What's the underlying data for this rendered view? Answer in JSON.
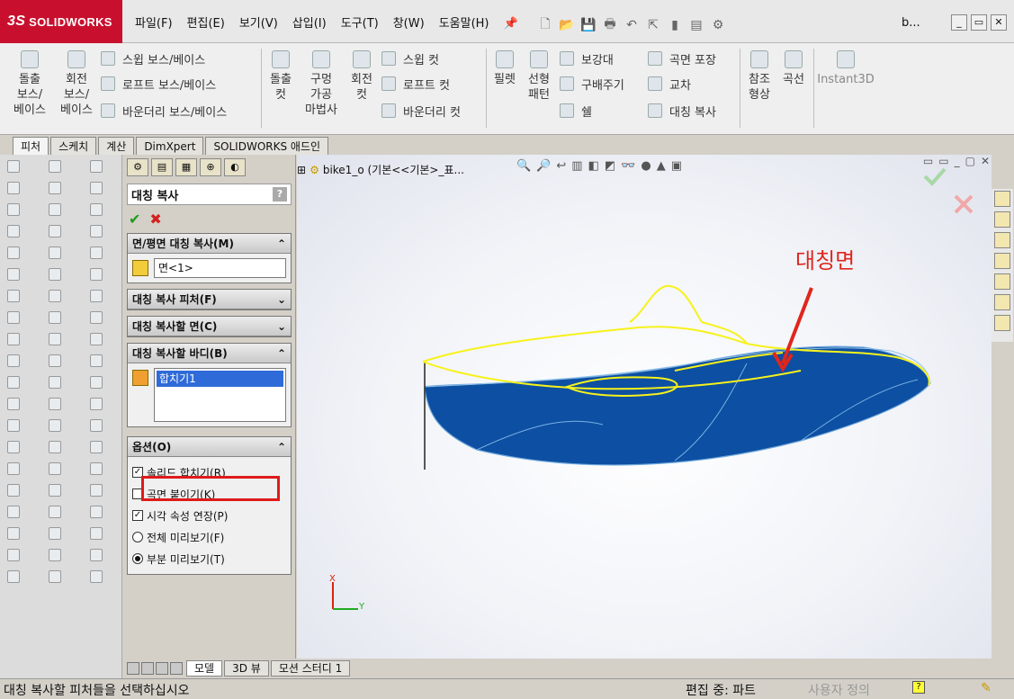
{
  "app": {
    "logo": "SOLIDWORKS",
    "doc_title": "b..."
  },
  "menu": [
    "파일(F)",
    "편집(E)",
    "보기(V)",
    "삽입(I)",
    "도구(T)",
    "창(W)",
    "도움말(H)"
  ],
  "ribbon": {
    "extrude_boss": "돌출\n보스/\n베이스",
    "revolve_boss": "회전\n보스/\n베이스",
    "sweep_boss": "스윕 보스/베이스",
    "loft_boss": "로프트 보스/베이스",
    "boundary_boss": "바운더리 보스/베이스",
    "extrude_cut": "돌출\n컷",
    "hole_wizard": "구멍\n가공\n마법사",
    "revolve_cut": "회전\n컷",
    "sweep_cut": "스윕 컷",
    "loft_cut": "로프트 컷",
    "boundary_cut": "바운더리 컷",
    "fillet": "필렛",
    "linear_pattern": "선형\n패턴",
    "rib": "보강대",
    "draft": "구배주기",
    "shell": "쉘",
    "wrap": "곡면 포장",
    "intersect": "교차",
    "mirror": "대칭 복사",
    "ref_geometry": "참조\n형상",
    "curves": "곡선",
    "instant3d": "Instant3D"
  },
  "tabs": [
    "피처",
    "스케치",
    "계산",
    "DimXpert",
    "SOLIDWORKS 애드인"
  ],
  "property_manager": {
    "title": "대칭 복사",
    "help": "?",
    "ok": "✔",
    "cancel": "✖",
    "face_plane": {
      "heading": "면/평면 대칭 복사(M)",
      "value": "면<1>"
    },
    "features": {
      "heading": "대칭 복사 피처(F)"
    },
    "faces": {
      "heading": "대칭 복사할 면(C)"
    },
    "bodies": {
      "heading": "대칭 복사할 바디(B)",
      "item": "합치기1"
    },
    "options": {
      "heading": "옵션(O)",
      "merge_solids": "솔리드 합치기(R)",
      "knit_surfaces": "곡면 붙이기(K)",
      "propagate_visual": "시각 속성 연장(P)",
      "full_preview": "전체 미리보기(F)",
      "partial_preview": "부분 미리보기(T)"
    }
  },
  "feature_tree_root": "bike1_o  (기본<<기본>_표...",
  "annotation": "대칭면",
  "triad": {
    "x": "X",
    "y": "Y"
  },
  "bottom_tabs": [
    "모델",
    "3D 뷰",
    "모션 스터디 1"
  ],
  "status": {
    "message": "대칭 복사할 피처들을 선택하십시오",
    "mode": "편집 중: 파트",
    "custom": "사용자 정의"
  }
}
